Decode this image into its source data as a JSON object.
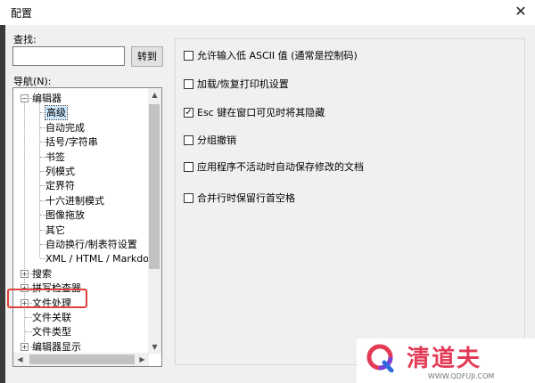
{
  "window": {
    "title": "配置",
    "close_glyph": "✕"
  },
  "find": {
    "label": "查找:",
    "value": "",
    "button": "转到"
  },
  "nav": {
    "label": "导航(N):",
    "tree": [
      {
        "label": "编辑器",
        "expander": "−"
      },
      {
        "label": "高级",
        "selected": true
      },
      {
        "label": "自动完成"
      },
      {
        "label": "括号/字符串"
      },
      {
        "label": "书签"
      },
      {
        "label": "列模式"
      },
      {
        "label": "定界符"
      },
      {
        "label": "十六进制模式"
      },
      {
        "label": "图像拖放"
      },
      {
        "label": "其它"
      },
      {
        "label": "自动换行/制表符设置"
      },
      {
        "label": "XML / HTML / Markdow"
      },
      {
        "label": "搜索",
        "expander": "+"
      },
      {
        "label": "拼写检查器",
        "expander": "+"
      },
      {
        "label": "文件处理",
        "expander": "+"
      },
      {
        "label": "文件关联"
      },
      {
        "label": "文件类型"
      },
      {
        "label": "编辑器显示",
        "expander": "+"
      }
    ]
  },
  "options": [
    {
      "label": "允许输入低 ASCII 值 (通常是控制码)",
      "checked": false
    },
    {
      "label": "加载/恢复打印机设置",
      "checked": false
    },
    {
      "label": "Esc 键在窗口可见时将其隐藏",
      "checked": true
    },
    {
      "label": "分组撤销",
      "checked": false
    },
    {
      "label": "应用程序不活动时自动保存修改的文档",
      "checked": false
    },
    {
      "label": "合并行时保留行首空格",
      "checked": false
    }
  ],
  "scroll_glyphs": {
    "up": "▲",
    "down": "▼",
    "left": "◀",
    "right": "▶"
  },
  "check_glyph": "✓",
  "watermark": {
    "name": "清道夫",
    "url": "WWW.QDFUJI.COM"
  },
  "colors": {
    "highlight": "#e0403a",
    "selection": "#cce8ff",
    "watermark": "#e33a55"
  }
}
